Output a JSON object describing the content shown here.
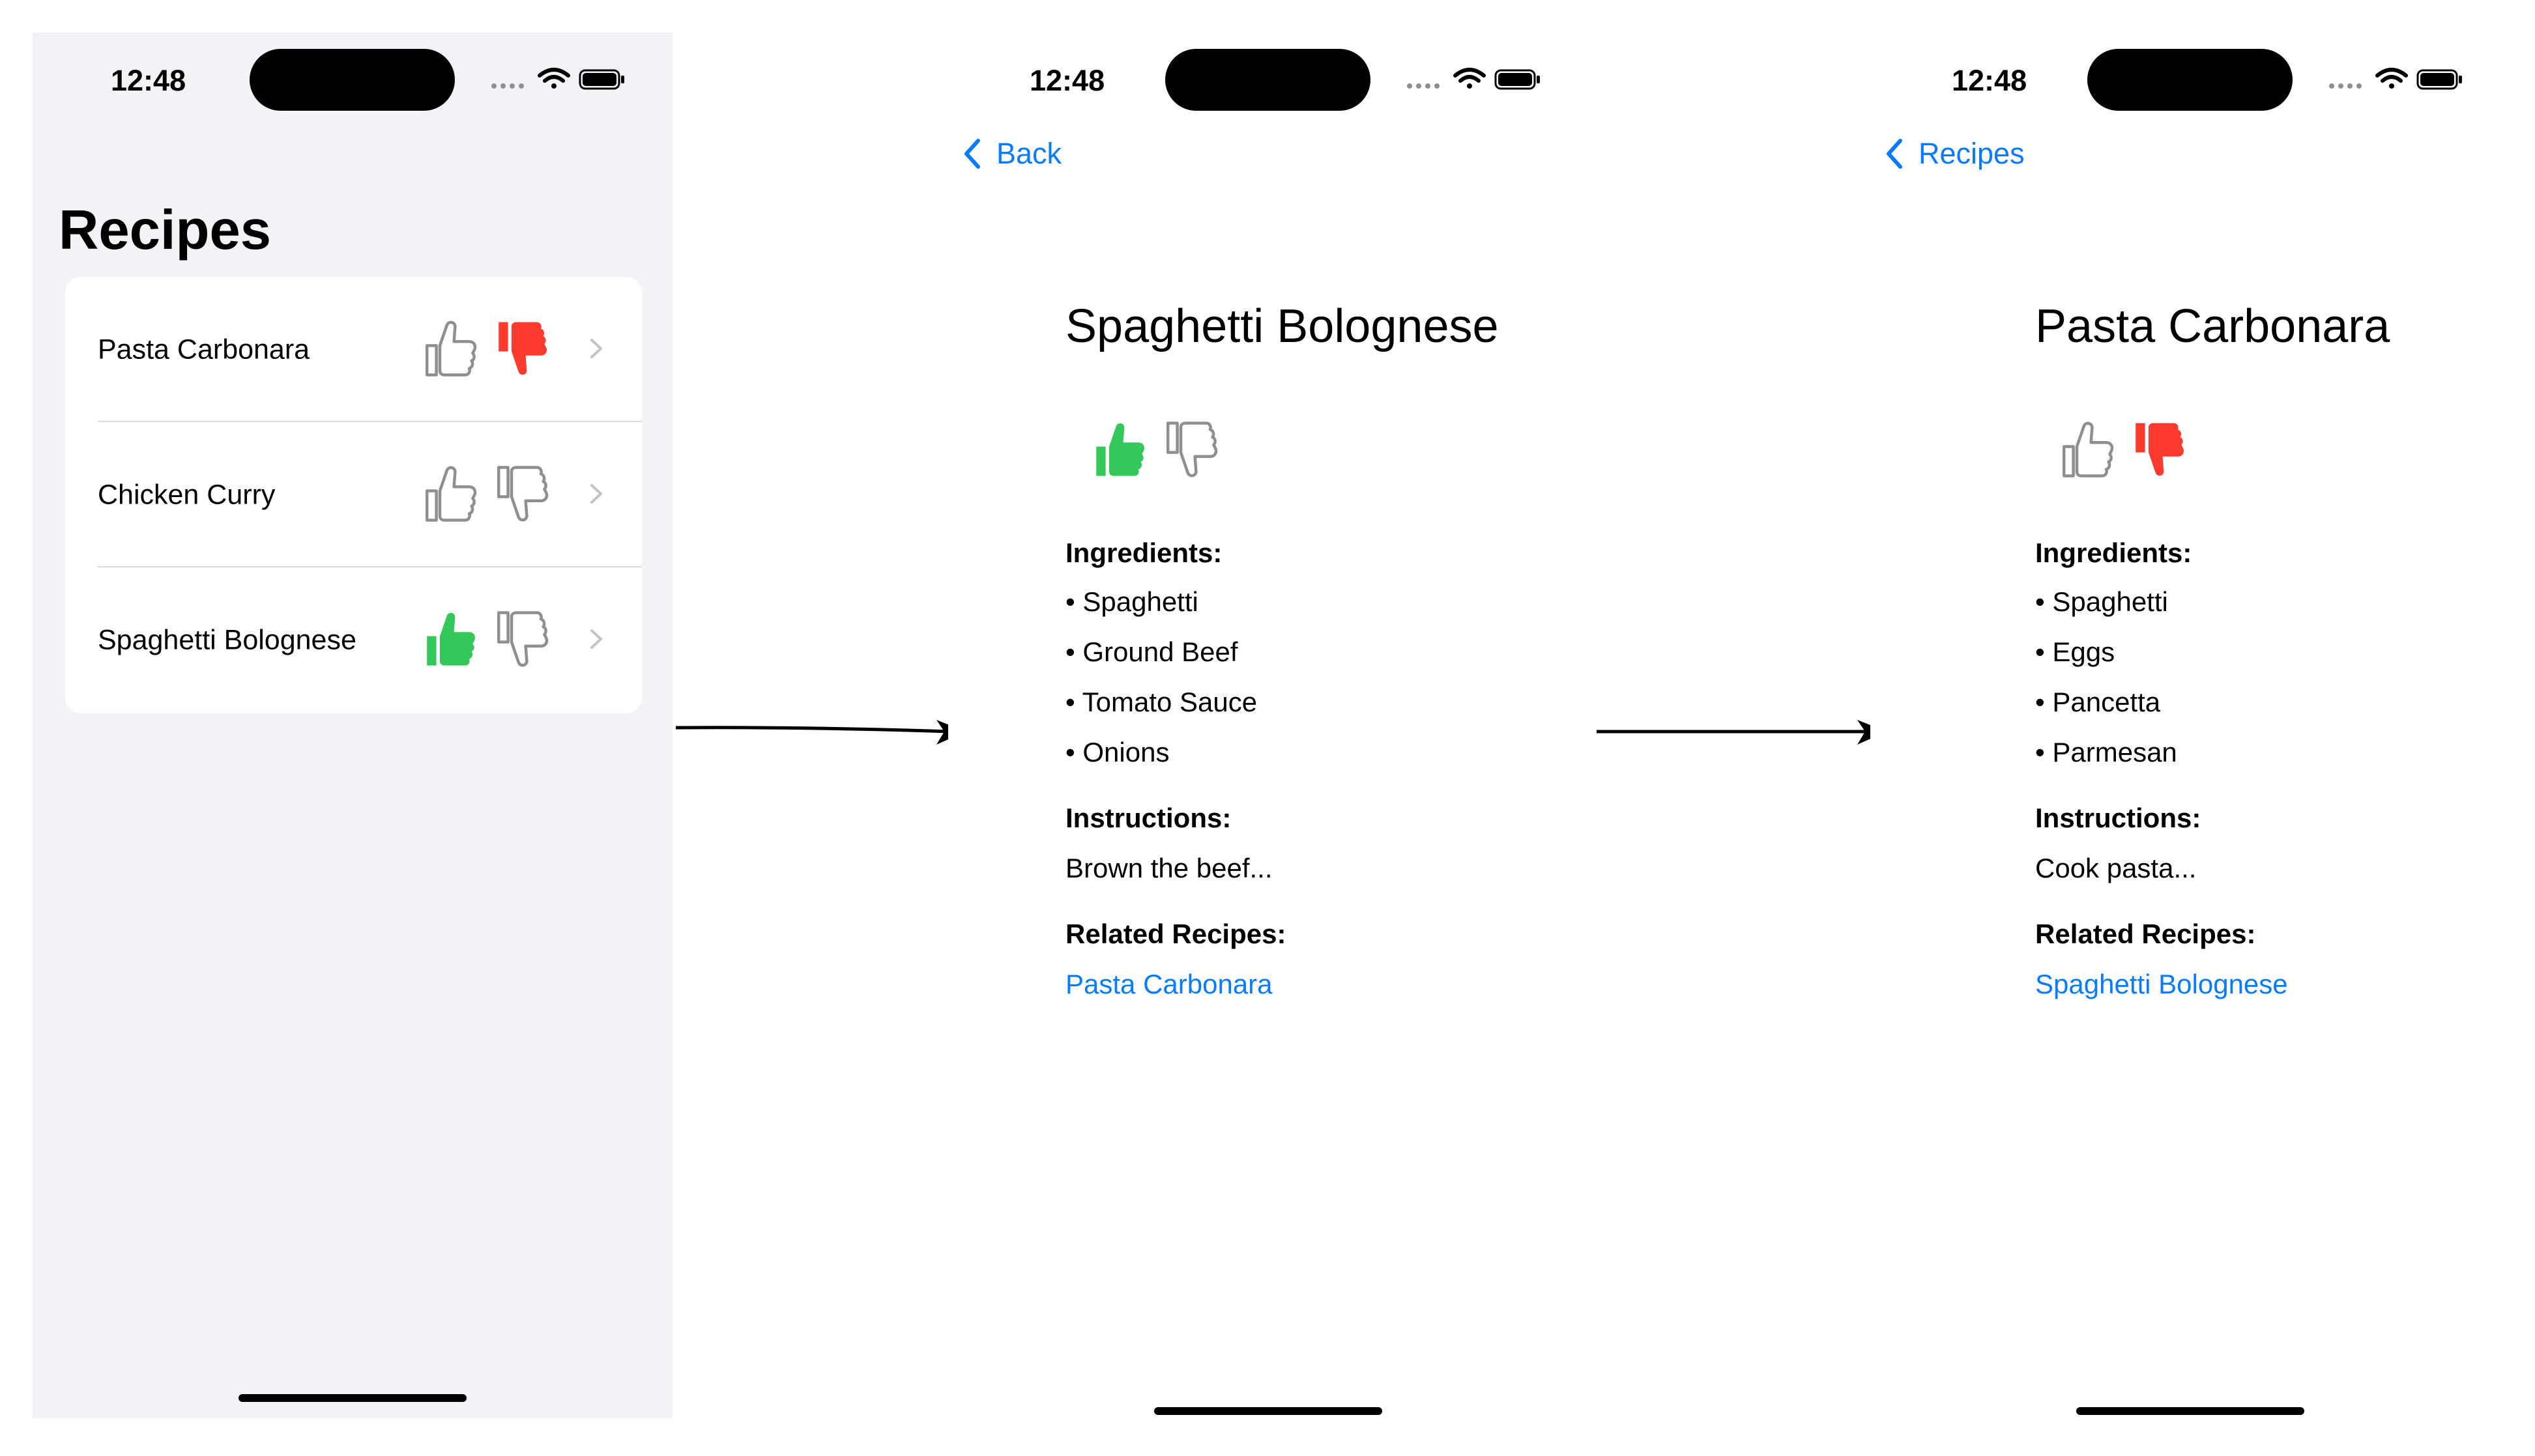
{
  "status_bar": {
    "time": "12:48"
  },
  "list_screen": {
    "title": "Recipes",
    "rows": [
      {
        "label": "Pasta Carbonara",
        "thumbs_up": false,
        "thumbs_down": true
      },
      {
        "label": "Chicken Curry",
        "thumbs_up": false,
        "thumbs_down": false
      },
      {
        "label": "Spaghetti Bolognese",
        "thumbs_up": true,
        "thumbs_down": false
      }
    ]
  },
  "detail_1": {
    "back_label": "Back",
    "title": "Spaghetti Bolognese",
    "thumbs_up": true,
    "thumbs_down": false,
    "ingredients_heading": "Ingredients:",
    "ingredients": [
      "• Spaghetti",
      "• Ground Beef",
      "• Tomato Sauce",
      "• Onions"
    ],
    "instructions_heading": "Instructions:",
    "instructions": "Brown the beef...",
    "related_heading": "Related Recipes:",
    "related": [
      "Pasta Carbonara"
    ]
  },
  "detail_2": {
    "back_label": "Recipes",
    "title": "Pasta Carbonara",
    "thumbs_up": false,
    "thumbs_down": true,
    "ingredients_heading": "Ingredients:",
    "ingredients": [
      "• Spaghetti",
      "• Eggs",
      "• Pancetta",
      "• Parmesan"
    ],
    "instructions_heading": "Instructions:",
    "instructions": "Cook pasta...",
    "related_heading": "Related Recipes:",
    "related": [
      "Spaghetti Bolognese"
    ]
  },
  "colors": {
    "accent": "#0a7aff",
    "thumb_up_active": "#34c759",
    "thumb_down_active": "#ff3b30",
    "thumb_inactive": "#8e8e93",
    "list_background": "#f2f2f7"
  },
  "icons": {
    "thumb_up": "hand-thumbsup-icon",
    "thumb_down": "hand-thumbsdown-icon",
    "chevron": "chevron-right-icon",
    "back": "chevron-left-icon",
    "wifi": "wifi-icon",
    "battery": "battery-icon",
    "signal": "cellular-signal-icon"
  }
}
